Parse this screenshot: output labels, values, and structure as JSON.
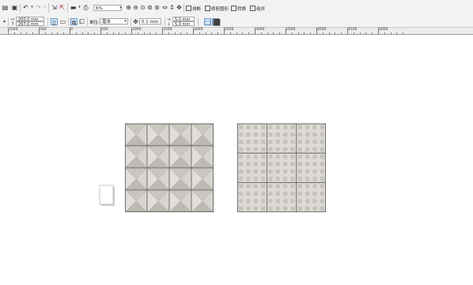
{
  "toolbar": {
    "zoom_value": "6%",
    "commands": {
      "arrange": "排断",
      "intersect": "修剪图形",
      "convert": "转换",
      "align": "组并"
    }
  },
  "property_bar": {
    "width": "200.0 mm",
    "height": "297.0 mm",
    "units_label": "单位:",
    "units_value": "毫米",
    "nudge": "0.1 mm",
    "dup_x": "5.0 mm",
    "dup_y": "5.0 mm"
  },
  "ruler": {
    "labels": [
      "1000",
      "500",
      "0",
      "500",
      "1000",
      "1500",
      "2000",
      "2500",
      "3000",
      "3500",
      "4000",
      "4500",
      "5000"
    ]
  },
  "colors": {
    "tile_fill": "#d6d3ce",
    "tile_border": "#555555",
    "toolbar_bg": "#f2f2f2"
  }
}
